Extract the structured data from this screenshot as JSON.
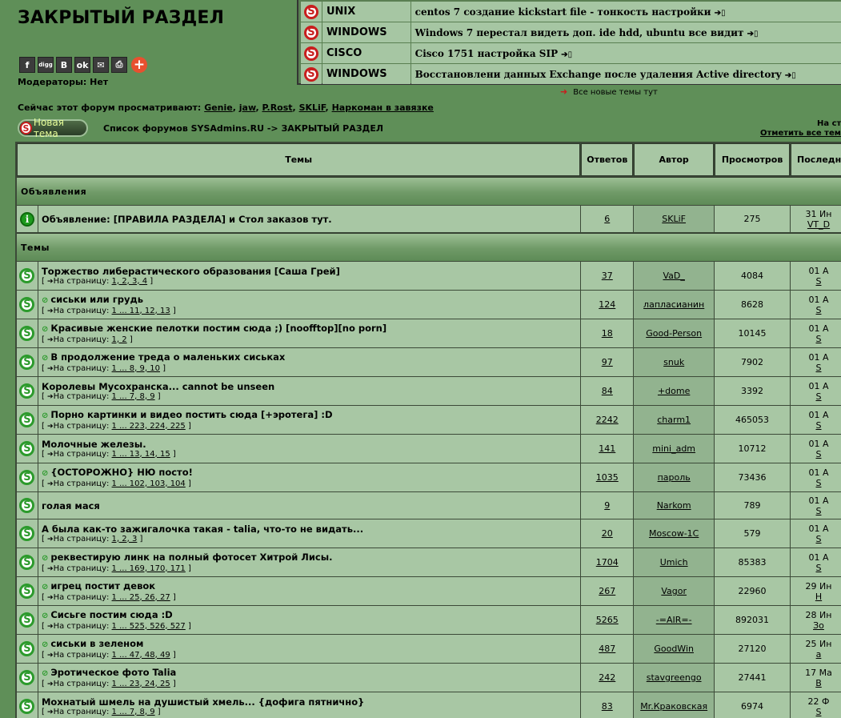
{
  "header": {
    "title": "ЗАКРЫТЫЙ РАЗДЕЛ",
    "moderators": "Модераторы: Нет",
    "viewers_label": "Сейчас этот форум просматривают:",
    "viewers": [
      "Genie",
      "jaw",
      "P.Rost",
      "SKLiF",
      "Наркоман в завязке"
    ]
  },
  "share": {
    "buttons": [
      {
        "icon": "facebook-icon",
        "glyph": "f"
      },
      {
        "icon": "digg-icon",
        "glyph": "digg"
      },
      {
        "icon": "vkontakte-icon",
        "glyph": "B"
      },
      {
        "icon": "odnoklassniki-icon",
        "glyph": "ok"
      },
      {
        "icon": "email-icon",
        "glyph": "✉"
      },
      {
        "icon": "print-icon",
        "glyph": "⎙"
      }
    ],
    "more_glyph": "+"
  },
  "new_topics": {
    "rows": [
      {
        "category": "UNIX",
        "title": "centos 7 создание kickstart file - тонкость настройки"
      },
      {
        "category": "WINDOWS",
        "title": "Windows 7 перестал видеть доп. ide hdd, ubuntu все видит"
      },
      {
        "category": "CISCO",
        "title": "Cisco 1751 настройка SIP"
      },
      {
        "category": "WINDOWS",
        "title": "Восстановлени данных Exchange после удаления Active directory"
      }
    ],
    "go_glyph": "➔▯",
    "all_new": "Все новые темы тут",
    "arrow_glyph": "➜"
  },
  "nav": {
    "new_topic": "Новая тема",
    "breadcrumb": "Список форумов SYSAdmins.RU -> ЗАКРЫТЫЙ РАЗДЕЛ",
    "right_top": "На ст",
    "mark_all": "Отметить все тем"
  },
  "table": {
    "headers": {
      "topics": "Темы",
      "replies": "Ответов",
      "author": "Автор",
      "views": "Просмотров",
      "last": "Последн"
    },
    "sections": {
      "announcements": "Объявления",
      "topics": "Темы"
    },
    "page_prefix": "На страницу:",
    "announcement": {
      "title": "Объявление: [ПРАВИЛА РАЗДЕЛА] и Стол заказов тут.",
      "replies": "6",
      "author": "SKLiF",
      "views": "275",
      "last1": "31 Ин",
      "last2": "VT_D"
    },
    "topics": [
      {
        "title": "Торжество либерастического образования [Саша Грей]",
        "attach": false,
        "pages": "1, 2, 3, 4",
        "replies": "37",
        "author": "VaD_",
        "views": "4084",
        "last1": "01 А",
        "last2": "S"
      },
      {
        "title": "сиськи или грудь",
        "attach": true,
        "pages": "1 ... 11, 12, 13",
        "replies": "124",
        "author": "лапласианин",
        "views": "8628",
        "last1": "01 А",
        "last2": "S"
      },
      {
        "title": "Красивые женские пелотки постим сюда ;) [noofftop][no porn]",
        "attach": true,
        "pages": "1, 2",
        "replies": "18",
        "author": "Good-Person",
        "views": "10145",
        "last1": "01 А",
        "last2": "S"
      },
      {
        "title": "В продолжение треда о маленьких сиськах",
        "attach": true,
        "pages": "1 ... 8, 9, 10",
        "replies": "97",
        "author": "snuk",
        "views": "7902",
        "last1": "01 А",
        "last2": "S"
      },
      {
        "title": "Королевы Мусохранска... cannot be unseen",
        "attach": false,
        "pages": "1 ... 7, 8, 9",
        "replies": "84",
        "author": "+dome",
        "views": "3392",
        "last1": "01 А",
        "last2": "S"
      },
      {
        "title": "Порно картинки и видео постить сюда [+эротега] :D",
        "attach": true,
        "pages": "1 ... 223, 224, 225",
        "replies": "2242",
        "author": "charm1",
        "views": "465053",
        "last1": "01 А",
        "last2": "S"
      },
      {
        "title": "Молочные железы.",
        "attach": false,
        "pages": "1 ... 13, 14, 15",
        "replies": "141",
        "author": "mini_adm",
        "views": "10712",
        "last1": "01 А",
        "last2": "S"
      },
      {
        "title": "{ОСТОРОЖНО} НЮ посто!",
        "attach": true,
        "pages": "1 ... 102, 103, 104",
        "replies": "1035",
        "author": "пароль",
        "views": "73436",
        "last1": "01 А",
        "last2": "S"
      },
      {
        "title": "голая мася",
        "attach": false,
        "pages": "",
        "replies": "9",
        "author": "Narkom",
        "views": "789",
        "last1": "01 А",
        "last2": "S"
      },
      {
        "title": "А была как-то зажигалочка такая - talia, что-то не видать...",
        "attach": false,
        "pages": "1, 2, 3",
        "replies": "20",
        "author": "Moscow-1C",
        "views": "579",
        "last1": "01 А",
        "last2": "S"
      },
      {
        "title": "реквестирую линк на полный фотосет Хитрой Лисы.",
        "attach": true,
        "pages": "1 ... 169, 170, 171",
        "replies": "1704",
        "author": "Umich",
        "views": "85383",
        "last1": "01 А",
        "last2": "S"
      },
      {
        "title": "игрец постит девок",
        "attach": true,
        "pages": "1 ... 25, 26, 27",
        "replies": "267",
        "author": "Vagor",
        "views": "22960",
        "last1": "29 Ин",
        "last2": "Н"
      },
      {
        "title": "Сисьге постим сюда :D",
        "attach": true,
        "pages": "1 ... 525, 526, 527",
        "replies": "5265",
        "author": "-=AIR=-",
        "views": "892031",
        "last1": "28 Ин",
        "last2": "Зо"
      },
      {
        "title": "сиськи в зеленом",
        "attach": true,
        "pages": "1 ... 47, 48, 49",
        "replies": "487",
        "author": "GoodWin",
        "views": "27120",
        "last1": "25 Ин",
        "last2": "а"
      },
      {
        "title": "Эротическое фото Talia",
        "attach": true,
        "pages": "1 ... 23, 24, 25",
        "replies": "242",
        "author": "stavgreengo",
        "views": "27441",
        "last1": "17 Ма",
        "last2": "В"
      },
      {
        "title": "Мохнатый шмель на душистый хмель... {дофига пятнично}",
        "attach": false,
        "pages": "1 ... 7, 8, 9",
        "replies": "83",
        "author": "Mr.Краковская",
        "views": "6974",
        "last1": "22 Ф",
        "last2": "S"
      }
    ]
  }
}
